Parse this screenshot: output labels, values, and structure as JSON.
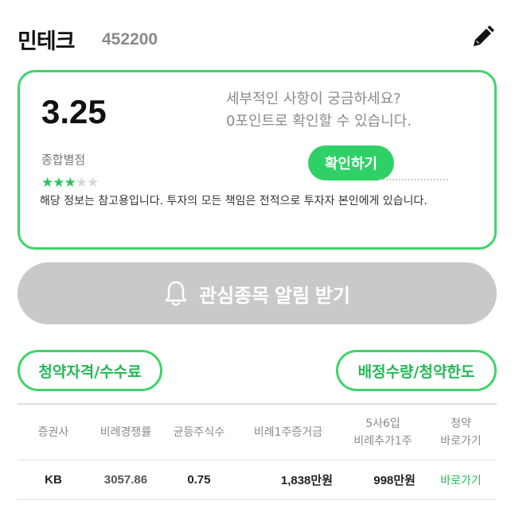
{
  "header": {
    "stock_name": "민테크",
    "stock_code": "452200",
    "edit_icon": "pencil-icon"
  },
  "score_card": {
    "score": "3.25",
    "score_label": "종합별점",
    "rating": {
      "filled": 3,
      "total": 5
    },
    "question_line1": "세부적인 사항이 궁금하세요?",
    "question_line2": "0포인트로 확인할 수 있습니다.",
    "check_button": "확인하기",
    "disclaimer": "해당 정보는 참고용입니다. 투자의 모든 책임은 전적으로 투자자 본인에게 있습니다."
  },
  "alert": {
    "label": "관심종목 알림 받기",
    "icon": "bell-icon"
  },
  "actions": {
    "eligibility": "청약자격/수수료",
    "allocation": "배정수량/청약한도"
  },
  "table": {
    "headers": [
      {
        "line1": "증권사",
        "line2": ""
      },
      {
        "line1": "비례경쟁률",
        "line2": ""
      },
      {
        "line1": "균등주식수",
        "line2": ""
      },
      {
        "line1": "비례1주증거금",
        "line2": ""
      },
      {
        "line1": "5사6입",
        "line2": "비례추가1주"
      },
      {
        "line1": "청약",
        "line2": "바로가기"
      }
    ],
    "rows": [
      {
        "broker": "KB",
        "ratio": "3057.86",
        "equal_shares": "0.75",
        "margin": "1,838만원",
        "extra": "998만원",
        "go": "바로가기"
      }
    ]
  },
  "colors": {
    "accent": "#2fd167",
    "border": "#3fd36b",
    "disabled": "#c9c9c9"
  }
}
